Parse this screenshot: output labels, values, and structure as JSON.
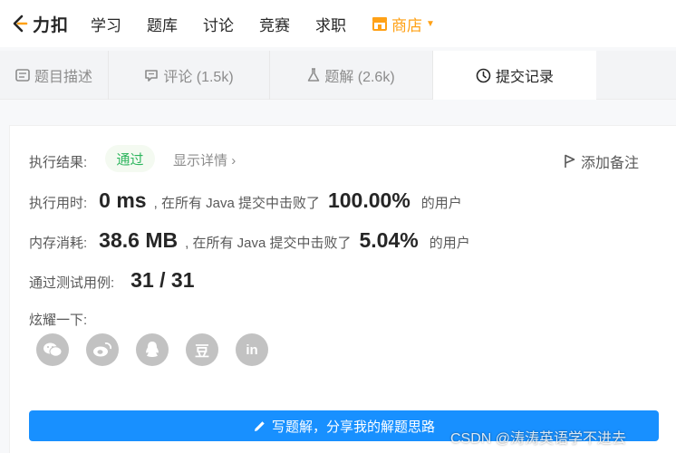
{
  "nav": {
    "logo_text": "力扣",
    "items": [
      "学习",
      "题库",
      "讨论",
      "竞赛",
      "求职"
    ],
    "store": "商店"
  },
  "tabs": [
    {
      "label": "题目描述"
    },
    {
      "label": "评论 (1.5k)"
    },
    {
      "label": "题解 (2.6k)"
    },
    {
      "label": "提交记录"
    }
  ],
  "result": {
    "label": "执行结果:",
    "status": "通过",
    "detail": "显示详情",
    "add_note": "添加备注"
  },
  "runtime": {
    "label": "执行用时:",
    "value": "0 ms",
    "mid": ", 在所有 Java 提交中击败了",
    "pct": "100.00%",
    "suffix": "的用户"
  },
  "memory": {
    "label": "内存消耗:",
    "value": "38.6 MB",
    "mid": ", 在所有 Java 提交中击败了",
    "pct": "5.04%",
    "suffix": "的用户"
  },
  "tests": {
    "label": "通过测试用例:",
    "value": "31 / 31"
  },
  "share": {
    "label": "炫耀一下:",
    "icons": [
      "wechat-icon",
      "weibo-icon",
      "qq-icon",
      "douban-icon",
      "linkedin-icon"
    ],
    "douban_glyph": "豆",
    "linkedin_glyph": "in"
  },
  "write_button": "写题解，分享我的解题思路",
  "watermark": "CSDN @涛涛英语学不进去",
  "colors": {
    "accent_orange": "#ffa116",
    "pass_green": "#2db55d",
    "primary_blue": "#1890ff"
  }
}
